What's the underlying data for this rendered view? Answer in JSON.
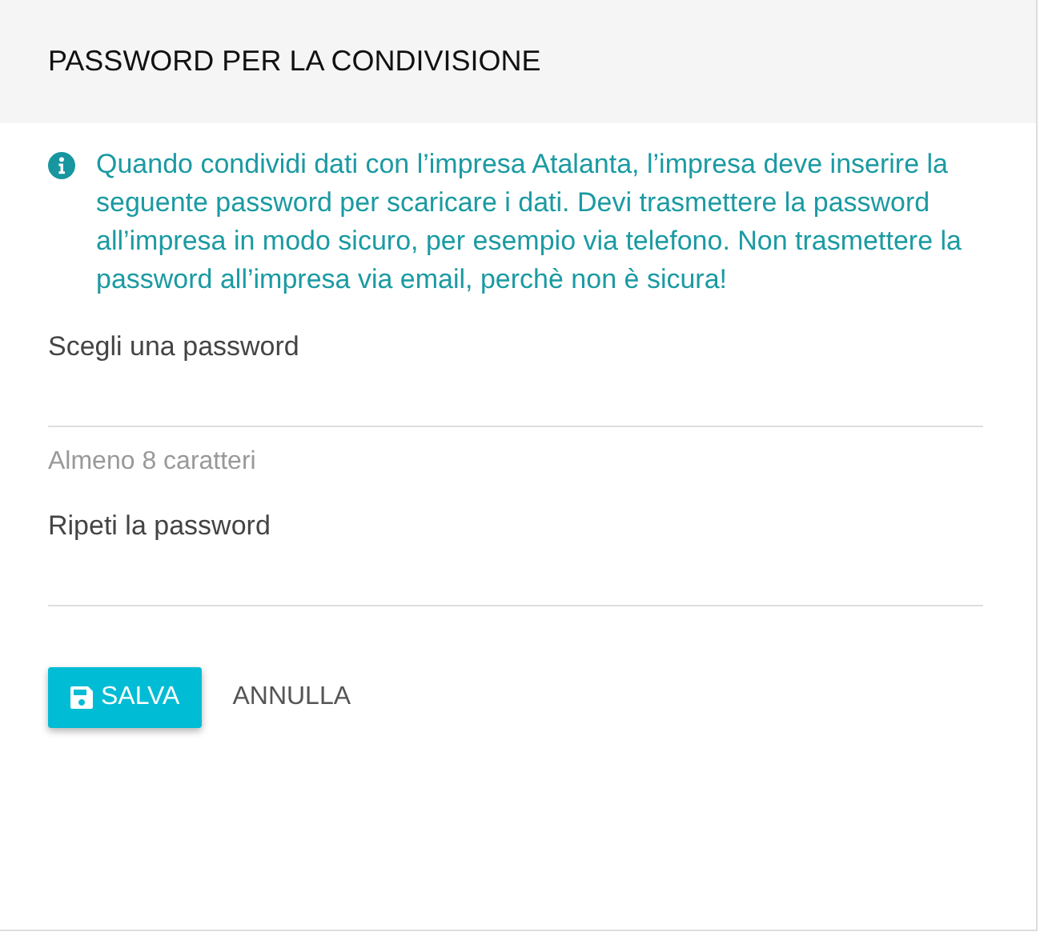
{
  "header": {
    "title": "PASSWORD PER LA CONDIVISIONE"
  },
  "info": {
    "text": "Quando condividi dati con l’impresa Atalanta, l’impresa deve inserire la seguente password per scaricare i dati. Devi trasmettere la password all’impresa in modo sicuro, per esempio via telefono. Non trasmettere la password all’impresa via email, perchè non è sicura!"
  },
  "fields": [
    {
      "label": "Scegli una password",
      "hint": "Almeno 8 caratteri"
    },
    {
      "label": "Ripeti la password"
    }
  ],
  "buttons": [
    {
      "kind": "primary",
      "label": "SALVA"
    },
    {
      "kind": "flat",
      "label": "ANNULLA"
    }
  ]
}
